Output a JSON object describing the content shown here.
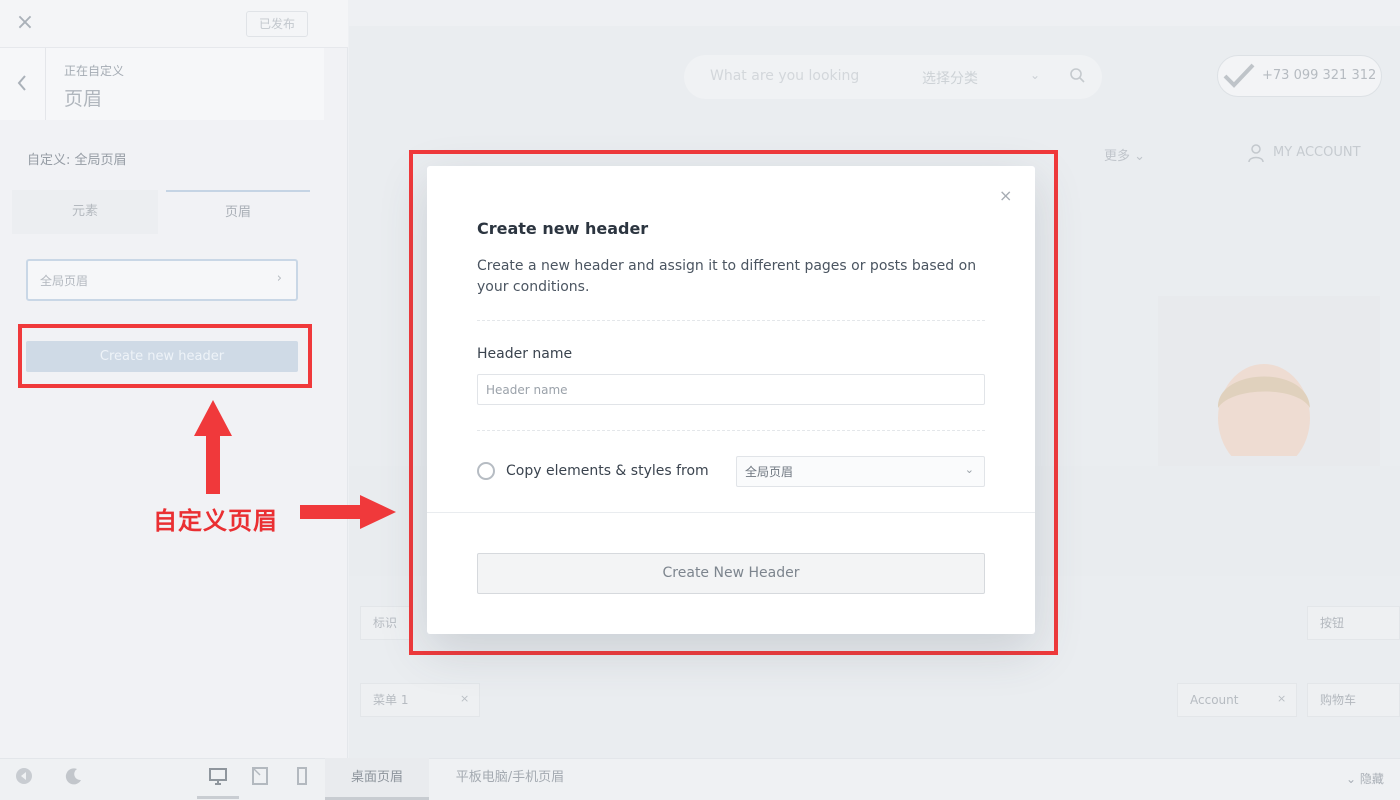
{
  "customizer": {
    "close_icon": "×",
    "published_label": "已发布",
    "breadcrumb_small": "正在自定义",
    "breadcrumb_title": "页眉",
    "customizing_label": "自定义: 全局页眉",
    "tabs": [
      {
        "label": "元素"
      },
      {
        "label": "页眉"
      }
    ],
    "header_select_label": "全局页眉",
    "header_select_chevron": "›",
    "create_button_label": "Create new header"
  },
  "bottom_bar": {
    "tabs": [
      {
        "label": "桌面页眉"
      },
      {
        "label": "平板电脑/手机页眉"
      }
    ],
    "hide_label": "隐藏"
  },
  "preview": {
    "search_placeholder": "What are you looking",
    "category_label": "选择分类",
    "phone": "+73 099 321 312",
    "nav_more": "更多",
    "account_label": "MY ACCOUNT",
    "builder_items": [
      "标识",
      "按钮",
      "菜单 1",
      "Account",
      "购物车"
    ],
    "remove_glyph": "×"
  },
  "annotation": {
    "label": "自定义页眉",
    "highlight_color": "#f0393b"
  },
  "modal": {
    "close_icon": "×",
    "title": "Create new header",
    "description": "Create a new header and assign it to different pages or posts based on your conditions.",
    "name_label": "Header name",
    "name_placeholder": "Header name",
    "name_value": "",
    "copy_label": "Copy elements & styles from",
    "copy_selected": "全局页眉",
    "copy_chevron": "⌄",
    "submit_label": "Create New Header"
  }
}
